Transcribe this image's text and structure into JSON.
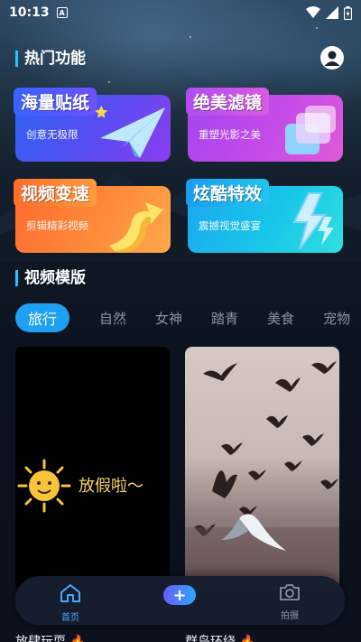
{
  "status_bar": {
    "time": "10:13"
  },
  "sections": {
    "hot_features": "热门功能",
    "video_templates": "视频模版"
  },
  "feature_cards": [
    {
      "title": "海量贴纸",
      "subtitle": "创意无极限"
    },
    {
      "title": "绝美滤镜",
      "subtitle": "重塑光影之美"
    },
    {
      "title": "视频变速",
      "subtitle": "剪辑精彩视频"
    },
    {
      "title": "炫酷特效",
      "subtitle": "震撼视觉盛宴"
    }
  ],
  "tabs": [
    "旅行",
    "自然",
    "女神",
    "踏青",
    "美食",
    "宠物"
  ],
  "thumbnails": [
    {
      "overlay_text": "放假啦～",
      "caption": "放肆玩耍 🔥"
    },
    {
      "caption": "群鸟环绕 🔥"
    }
  ],
  "bottom_nav": {
    "home": "首页",
    "add": "+",
    "shoot": "拍摄"
  },
  "colors": {
    "accent": "#1ea1f2",
    "nav_active": "#4aa8ff"
  }
}
